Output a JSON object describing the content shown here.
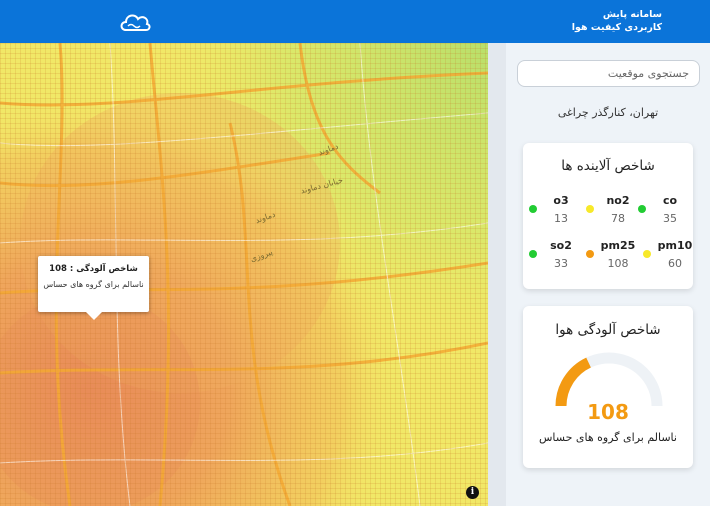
{
  "header": {
    "brand_line1": "سامانه پایش",
    "brand_line2": "کاربردی کیفیت هوا",
    "logo_icon": "cloud-icon"
  },
  "map": {
    "labels": [
      "خیابان دماوند",
      "دماوند",
      "پیروزی",
      "دماوند"
    ],
    "popup": {
      "title": "شاخص آلودگی : 108",
      "status": "ناسالم برای گروه های حساس"
    },
    "info_icon": "info-icon"
  },
  "search": {
    "placeholder": "جستجوی موقعیت"
  },
  "station": {
    "name": "تهران، کنارگذر چراغی"
  },
  "pollutants": {
    "title": "شاخص آلاینده ها",
    "items": [
      {
        "name": "co",
        "value": "35",
        "color": "#22cc33"
      },
      {
        "name": "no2",
        "value": "78",
        "color": "#f7e92a"
      },
      {
        "name": "o3",
        "value": "13",
        "color": "#22cc33"
      },
      {
        "name": "pm10",
        "value": "60",
        "color": "#f7e92a"
      },
      {
        "name": "pm25",
        "value": "108",
        "color": "#f39a12"
      },
      {
        "name": "so2",
        "value": "33",
        "color": "#22cc33"
      }
    ]
  },
  "aqi": {
    "title": "شاخص آلودگی هوا",
    "value": "108",
    "value_fraction": 0.36,
    "status": "ناسالم برای گروه های حساس",
    "color": "#f39a12"
  },
  "colors": {
    "header": "#0b74d9",
    "good": "#22cc33",
    "moderate": "#f7e92a",
    "sensitive": "#f39a12"
  }
}
